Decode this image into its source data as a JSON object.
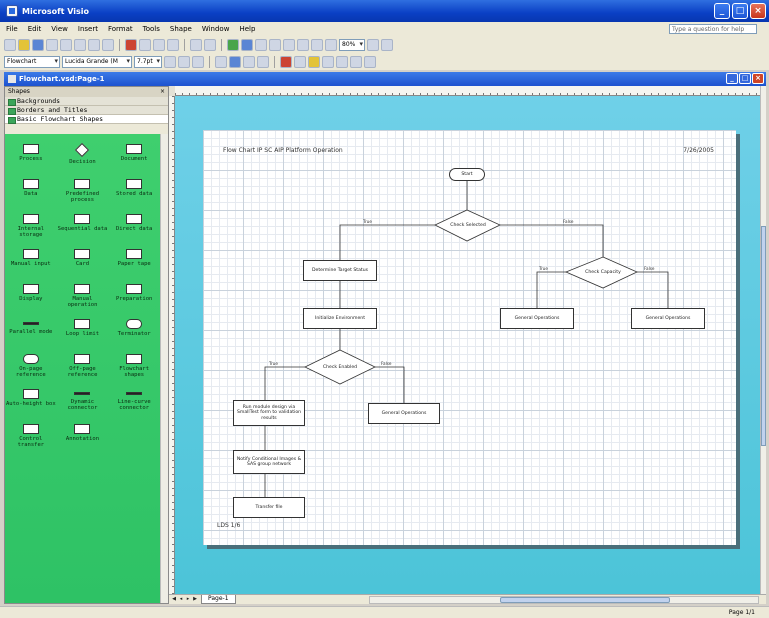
{
  "window": {
    "title": "Microsoft Visio"
  },
  "menu": [
    "File",
    "Edit",
    "View",
    "Insert",
    "Format",
    "Tools",
    "Shape",
    "Window",
    "Help"
  ],
  "help_placeholder": "Type a question for help",
  "toolbar": {
    "style_combo": "Flowchart",
    "font_combo": "Lucida Grande (M",
    "size_combo": "7.7pt",
    "zoom_combo": "80%"
  },
  "document": {
    "title": "Flowchart.vsd:Page-1"
  },
  "shapes_panel": {
    "header": "Shapes",
    "stencils": [
      "Backgrounds",
      "Borders and Titles",
      "Basic Flowchart Shapes"
    ],
    "items": [
      {
        "label": "Process",
        "shape": "rect"
      },
      {
        "label": "Decision",
        "shape": "diam"
      },
      {
        "label": "Document",
        "shape": "rect"
      },
      {
        "label": "Data",
        "shape": "rect"
      },
      {
        "label": "Predefined process",
        "shape": "rect"
      },
      {
        "label": "Stored data",
        "shape": "rect"
      },
      {
        "label": "Internal storage",
        "shape": "rect"
      },
      {
        "label": "Sequential data",
        "shape": "rect"
      },
      {
        "label": "Direct data",
        "shape": "rect"
      },
      {
        "label": "Manual input",
        "shape": "rect"
      },
      {
        "label": "Card",
        "shape": "rect"
      },
      {
        "label": "Paper tape",
        "shape": "rect"
      },
      {
        "label": "Display",
        "shape": "rect"
      },
      {
        "label": "Manual operation",
        "shape": "rect"
      },
      {
        "label": "Preparation",
        "shape": "rect"
      },
      {
        "label": "Parallel mode",
        "shape": "line"
      },
      {
        "label": "Loop limit",
        "shape": "rect"
      },
      {
        "label": "Terminator",
        "shape": "round"
      },
      {
        "label": "On-page reference",
        "shape": "round"
      },
      {
        "label": "Off-page reference",
        "shape": "rect"
      },
      {
        "label": "Flowchart shapes",
        "shape": "rect"
      },
      {
        "label": "Auto-height box",
        "shape": "rect"
      },
      {
        "label": "Dynamic connector",
        "shape": "line"
      },
      {
        "label": "Line-curve connector",
        "shape": "line"
      },
      {
        "label": "Control transfer",
        "shape": "rect"
      },
      {
        "label": "Annotation",
        "shape": "rect"
      }
    ]
  },
  "diagram": {
    "title": "Flow Chart IP SC AIP Platform Operation",
    "date": "7/26/2005",
    "footer": "LDS 1/6",
    "nodes": {
      "start": "Start",
      "d1": "Check Selected",
      "p1": "Determine Target Status",
      "d2": "Check Capacity",
      "p2": "Initialize Environment",
      "p3": "General Operations",
      "p4": "General Operations",
      "d3": "Check Enabled",
      "p5": "Run module design via SmallTest form to validation results",
      "p6": "General Operations",
      "p7": "Notify Conditional Images & SAS group network",
      "p8": "Transfer file"
    },
    "edges": {
      "d1_left": "True",
      "d1_right": "False",
      "d2_left": "True",
      "d2_right": "False",
      "d3_left": "True",
      "d3_right": "False"
    }
  },
  "tabs": {
    "page": "Page-1"
  },
  "status": {
    "page": "Page 1/1"
  }
}
